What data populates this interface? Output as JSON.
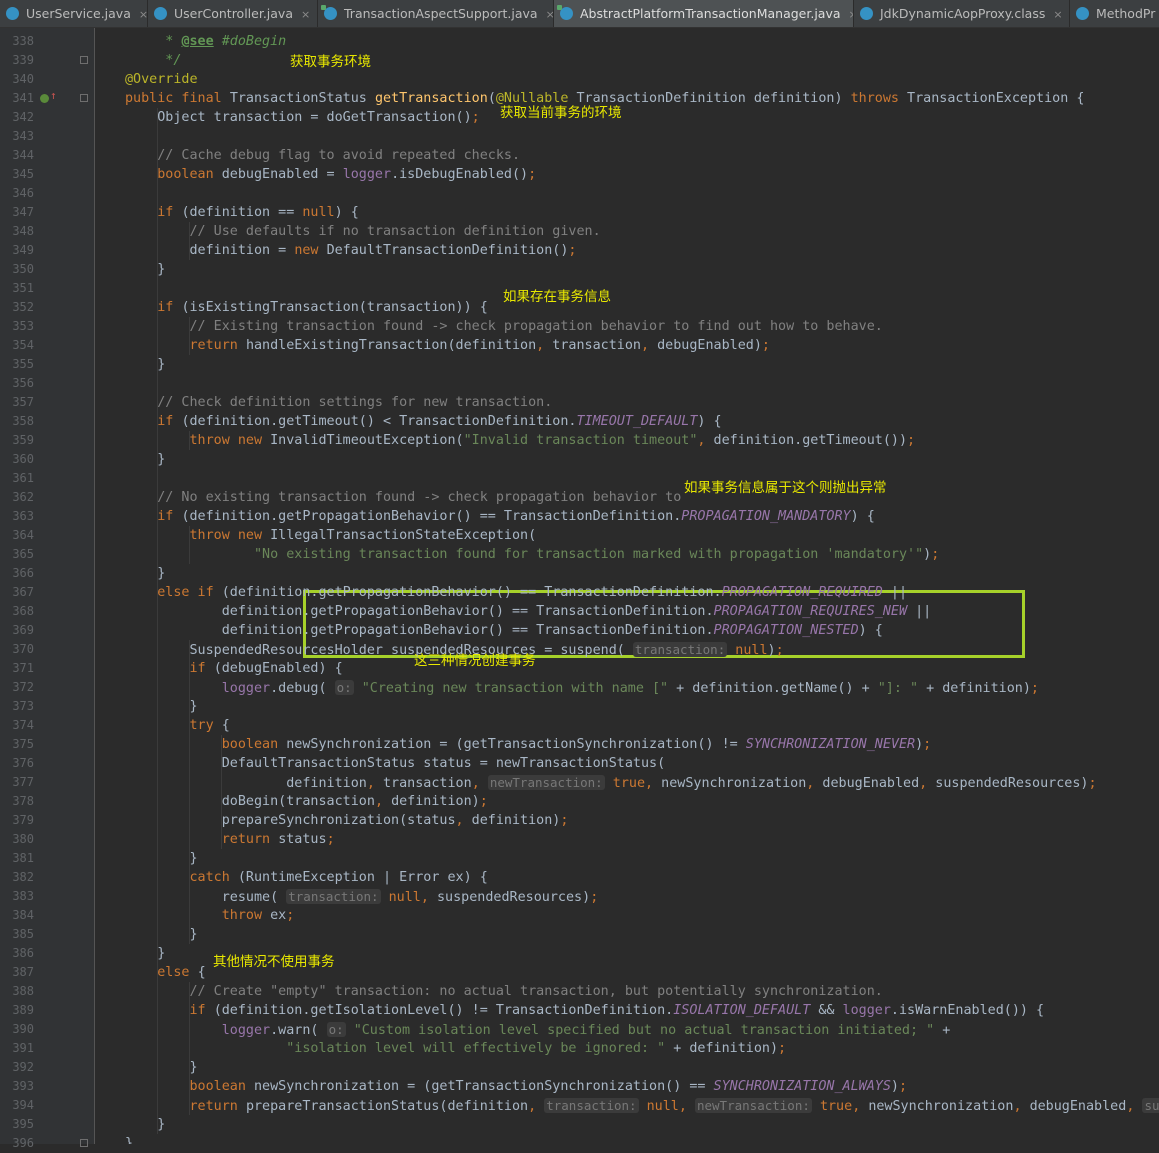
{
  "tabs": [
    {
      "label": "UserService.java",
      "icon": "java-class-icon",
      "active": false
    },
    {
      "label": "UserController.java",
      "icon": "java-class-icon",
      "active": false
    },
    {
      "label": "TransactionAspectSupport.java",
      "icon": "java-class-icon",
      "active": false
    },
    {
      "label": "AbstractPlatformTransactionManager.java",
      "icon": "java-class-icon",
      "active": true
    },
    {
      "label": "JdkDynamicAopProxy.class",
      "icon": "java-class-icon",
      "active": false
    },
    {
      "label": "MethodPr",
      "icon": "java-class-icon",
      "active": false
    }
  ],
  "line_numbers": [
    "338",
    "339",
    "340",
    "341",
    "342",
    "343",
    "344",
    "345",
    "346",
    "347",
    "348",
    "349",
    "350",
    "351",
    "352",
    "353",
    "354",
    "355",
    "356",
    "357",
    "358",
    "359",
    "360",
    "361",
    "362",
    "363",
    "364",
    "365",
    "366",
    "367",
    "368",
    "369",
    "370",
    "371",
    "372",
    "373",
    "374",
    "375",
    "376",
    "377",
    "378",
    "379",
    "380",
    "381",
    "382",
    "383",
    "384",
    "385",
    "386",
    "387",
    "388",
    "389",
    "390",
    "391",
    "392",
    "393",
    "394",
    "395",
    "396"
  ],
  "code_lines": [
    {
      "indent": "    ",
      "tokens": [
        [
          "jd",
          " * "
        ],
        [
          "jt",
          "@see"
        ],
        [
          "jd",
          " #doBegin"
        ]
      ]
    },
    {
      "indent": "    ",
      "tokens": [
        [
          "jd",
          " */"
        ]
      ]
    },
    {
      "indent": "",
      "tokens": [
        [
          "an",
          "@Override"
        ]
      ]
    },
    {
      "indent": "",
      "tokens": [
        [
          "kw",
          "public final "
        ],
        [
          "",
          "TransactionStatus "
        ],
        [
          "fn",
          "getTransaction"
        ],
        [
          "",
          "("
        ],
        [
          "an",
          "@Nullable "
        ],
        [
          "",
          "TransactionDefinition definition) "
        ],
        [
          "kw",
          "throws "
        ],
        [
          "",
          "TransactionException {"
        ]
      ]
    },
    {
      "indent": "    ",
      "tokens": [
        [
          "",
          "Object transaction = doGetTransaction()"
        ],
        [
          "kw",
          ";"
        ]
      ]
    },
    {
      "indent": "",
      "tokens": []
    },
    {
      "indent": "    ",
      "tokens": [
        [
          "cm",
          "// Cache debug flag to avoid repeated checks."
        ]
      ]
    },
    {
      "indent": "    ",
      "tokens": [
        [
          "kw",
          "boolean "
        ],
        [
          "",
          "debugEnabled = "
        ],
        [
          "fld",
          "logger"
        ],
        [
          "",
          ".isDebugEnabled()"
        ],
        [
          "kw",
          ";"
        ]
      ]
    },
    {
      "indent": "",
      "tokens": []
    },
    {
      "indent": "    ",
      "tokens": [
        [
          "kw",
          "if "
        ],
        [
          "",
          "(definition == "
        ],
        [
          "kw",
          "null"
        ],
        [
          "",
          ") {"
        ]
      ]
    },
    {
      "indent": "        ",
      "tokens": [
        [
          "cm",
          "// Use defaults if no transaction definition given."
        ]
      ]
    },
    {
      "indent": "        ",
      "tokens": [
        [
          "",
          "definition = "
        ],
        [
          "kw",
          "new "
        ],
        [
          "",
          "DefaultTransactionDefinition()"
        ],
        [
          "kw",
          ";"
        ]
      ]
    },
    {
      "indent": "    ",
      "tokens": [
        [
          "",
          "}"
        ]
      ]
    },
    {
      "indent": "",
      "tokens": []
    },
    {
      "indent": "    ",
      "tokens": [
        [
          "kw",
          "if "
        ],
        [
          "",
          "(isExistingTransaction(transaction)) {"
        ]
      ]
    },
    {
      "indent": "        ",
      "tokens": [
        [
          "cm",
          "// Existing transaction found -> check propagation behavior to find out how to behave."
        ]
      ]
    },
    {
      "indent": "        ",
      "tokens": [
        [
          "kw",
          "return "
        ],
        [
          "",
          "handleExistingTransaction(definition"
        ],
        [
          "kw",
          ", "
        ],
        [
          "",
          "transaction"
        ],
        [
          "kw",
          ", "
        ],
        [
          "",
          "debugEnabled)"
        ],
        [
          "kw",
          ";"
        ]
      ]
    },
    {
      "indent": "    ",
      "tokens": [
        [
          "",
          "}"
        ]
      ]
    },
    {
      "indent": "",
      "tokens": []
    },
    {
      "indent": "    ",
      "tokens": [
        [
          "cm",
          "// Check definition settings for new transaction."
        ]
      ]
    },
    {
      "indent": "    ",
      "tokens": [
        [
          "kw",
          "if "
        ],
        [
          "",
          "(definition.getTimeout() < TransactionDefinition."
        ],
        [
          "cn",
          "TIMEOUT_DEFAULT"
        ],
        [
          "",
          ") {"
        ]
      ]
    },
    {
      "indent": "        ",
      "tokens": [
        [
          "kw",
          "throw new "
        ],
        [
          "",
          "InvalidTimeoutException("
        ],
        [
          "st",
          "\"Invalid transaction timeout\""
        ],
        [
          "kw",
          ", "
        ],
        [
          "",
          "definition.getTimeout())"
        ],
        [
          "kw",
          ";"
        ]
      ]
    },
    {
      "indent": "    ",
      "tokens": [
        [
          "",
          "}"
        ]
      ]
    },
    {
      "indent": "",
      "tokens": []
    },
    {
      "indent": "    ",
      "tokens": [
        [
          "cm",
          "// No existing transaction found -> check propagation behavior to "
        ]
      ]
    },
    {
      "indent": "    ",
      "tokens": [
        [
          "kw",
          "if "
        ],
        [
          "",
          "(definition.getPropagationBehavior() == TransactionDefinition."
        ],
        [
          "cn",
          "PROPAGATION_MANDATORY"
        ],
        [
          "",
          ") {"
        ]
      ]
    },
    {
      "indent": "        ",
      "tokens": [
        [
          "kw",
          "throw new "
        ],
        [
          "",
          "IllegalTransactionStateException("
        ]
      ]
    },
    {
      "indent": "                ",
      "tokens": [
        [
          "st",
          "\"No existing transaction found for transaction marked with propagation 'mandatory'\""
        ],
        [
          "",
          ")"
        ],
        [
          "kw",
          ";"
        ]
      ]
    },
    {
      "indent": "    ",
      "tokens": [
        [
          "",
          "}"
        ]
      ]
    },
    {
      "indent": "    ",
      "tokens": [
        [
          "kw",
          "else if "
        ],
        [
          "",
          "(definition.getPropagationBehavior() == TransactionDefinition."
        ],
        [
          "cn",
          "PROPAGATION_REQUIRED"
        ],
        [
          "",
          " ||"
        ]
      ]
    },
    {
      "indent": "            ",
      "tokens": [
        [
          "",
          "definition.getPropagationBehavior() == TransactionDefinition."
        ],
        [
          "cn",
          "PROPAGATION_REQUIRES_NEW"
        ],
        [
          "",
          " ||"
        ]
      ]
    },
    {
      "indent": "            ",
      "tokens": [
        [
          "",
          "definition.getPropagationBehavior() == TransactionDefinition."
        ],
        [
          "cn",
          "PROPAGATION_NESTED"
        ],
        [
          "",
          ") {"
        ]
      ]
    },
    {
      "indent": "        ",
      "tokens": [
        [
          "",
          "SuspendedResourcesHolder suspendedResources = suspend( "
        ],
        [
          "hint",
          "transaction:"
        ],
        [
          "",
          " "
        ],
        [
          "kw",
          "null"
        ],
        [
          "",
          ")"
        ],
        [
          "kw",
          ";"
        ]
      ]
    },
    {
      "indent": "        ",
      "tokens": [
        [
          "kw",
          "if "
        ],
        [
          "",
          "(debugEnabled) {"
        ]
      ]
    },
    {
      "indent": "            ",
      "tokens": [
        [
          "fld",
          "logger"
        ],
        [
          "",
          ".debug( "
        ],
        [
          "hint",
          "o:"
        ],
        [
          "",
          " "
        ],
        [
          "st",
          "\"Creating new transaction with name [\""
        ],
        [
          "",
          " + definition.getName() + "
        ],
        [
          "st",
          "\"]: \""
        ],
        [
          "",
          " + definition)"
        ],
        [
          "kw",
          ";"
        ]
      ]
    },
    {
      "indent": "        ",
      "tokens": [
        [
          "",
          "}"
        ]
      ]
    },
    {
      "indent": "        ",
      "tokens": [
        [
          "kw",
          "try "
        ],
        [
          "",
          "{"
        ]
      ]
    },
    {
      "indent": "            ",
      "tokens": [
        [
          "kw",
          "boolean "
        ],
        [
          "",
          "newSynchronization = (getTransactionSynchronization() != "
        ],
        [
          "cn",
          "SYNCHRONIZATION_NEVER"
        ],
        [
          "",
          ")"
        ],
        [
          "kw",
          ";"
        ]
      ]
    },
    {
      "indent": "            ",
      "tokens": [
        [
          "",
          "DefaultTransactionStatus status = newTransactionStatus("
        ]
      ]
    },
    {
      "indent": "                    ",
      "tokens": [
        [
          "",
          "definition"
        ],
        [
          "kw",
          ", "
        ],
        [
          "",
          "transaction"
        ],
        [
          "kw",
          ", "
        ],
        [
          "hint",
          "newTransaction:"
        ],
        [
          "",
          " "
        ],
        [
          "kw",
          "true"
        ],
        [
          "kw",
          ", "
        ],
        [
          "",
          "newSynchronization"
        ],
        [
          "kw",
          ", "
        ],
        [
          "",
          "debugEnabled"
        ],
        [
          "kw",
          ", "
        ],
        [
          "",
          "suspendedResources)"
        ],
        [
          "kw",
          ";"
        ]
      ]
    },
    {
      "indent": "            ",
      "tokens": [
        [
          "",
          "doBegin(transaction"
        ],
        [
          "kw",
          ", "
        ],
        [
          "",
          "definition)"
        ],
        [
          "kw",
          ";"
        ]
      ]
    },
    {
      "indent": "            ",
      "tokens": [
        [
          "",
          "prepareSynchronization(status"
        ],
        [
          "kw",
          ", "
        ],
        [
          "",
          "definition)"
        ],
        [
          "kw",
          ";"
        ]
      ]
    },
    {
      "indent": "            ",
      "tokens": [
        [
          "kw",
          "return "
        ],
        [
          "",
          "status"
        ],
        [
          "kw",
          ";"
        ]
      ]
    },
    {
      "indent": "        ",
      "tokens": [
        [
          "",
          "}"
        ]
      ]
    },
    {
      "indent": "        ",
      "tokens": [
        [
          "kw",
          "catch "
        ],
        [
          "",
          "(RuntimeException | Error ex) {"
        ]
      ]
    },
    {
      "indent": "            ",
      "tokens": [
        [
          "",
          "resume( "
        ],
        [
          "hint",
          "transaction:"
        ],
        [
          "",
          " "
        ],
        [
          "kw",
          "null"
        ],
        [
          "kw",
          ", "
        ],
        [
          "",
          "suspendedResources)"
        ],
        [
          "kw",
          ";"
        ]
      ]
    },
    {
      "indent": "            ",
      "tokens": [
        [
          "kw",
          "throw "
        ],
        [
          "",
          "ex"
        ],
        [
          "kw",
          ";"
        ]
      ]
    },
    {
      "indent": "        ",
      "tokens": [
        [
          "",
          "}"
        ]
      ]
    },
    {
      "indent": "    ",
      "tokens": [
        [
          "",
          "}"
        ]
      ]
    },
    {
      "indent": "    ",
      "tokens": [
        [
          "kw",
          "else "
        ],
        [
          "",
          "{"
        ]
      ]
    },
    {
      "indent": "        ",
      "tokens": [
        [
          "cm",
          "// Create \"empty\" transaction: no actual transaction, but potentially synchronization."
        ]
      ]
    },
    {
      "indent": "        ",
      "tokens": [
        [
          "kw",
          "if "
        ],
        [
          "",
          "(definition.getIsolationLevel() != TransactionDefinition."
        ],
        [
          "cn",
          "ISOLATION_DEFAULT"
        ],
        [
          "",
          " && "
        ],
        [
          "fld",
          "logger"
        ],
        [
          "",
          ".isWarnEnabled()) {"
        ]
      ]
    },
    {
      "indent": "            ",
      "tokens": [
        [
          "fld",
          "logger"
        ],
        [
          "",
          ".warn( "
        ],
        [
          "hint",
          "o:"
        ],
        [
          "",
          " "
        ],
        [
          "st",
          "\"Custom isolation level specified but no actual transaction initiated; \""
        ],
        [
          "",
          " +"
        ]
      ]
    },
    {
      "indent": "                    ",
      "tokens": [
        [
          "st",
          "\"isolation level will effectively be ignored: \""
        ],
        [
          "",
          " + definition)"
        ],
        [
          "kw",
          ";"
        ]
      ]
    },
    {
      "indent": "        ",
      "tokens": [
        [
          "",
          "}"
        ]
      ]
    },
    {
      "indent": "        ",
      "tokens": [
        [
          "kw",
          "boolean "
        ],
        [
          "",
          "newSynchronization = (getTransactionSynchronization() == "
        ],
        [
          "cn",
          "SYNCHRONIZATION_ALWAYS"
        ],
        [
          "",
          ")"
        ],
        [
          "kw",
          ";"
        ]
      ]
    },
    {
      "indent": "        ",
      "tokens": [
        [
          "kw",
          "return "
        ],
        [
          "",
          "prepareTransactionStatus(definition"
        ],
        [
          "kw",
          ", "
        ],
        [
          "hint",
          "transaction:"
        ],
        [
          "",
          " "
        ],
        [
          "kw",
          "null"
        ],
        [
          "kw",
          ", "
        ],
        [
          "hint",
          "newTransaction:"
        ],
        [
          "",
          " "
        ],
        [
          "kw",
          "true"
        ],
        [
          "kw",
          ", "
        ],
        [
          "",
          "newSynchronization"
        ],
        [
          "kw",
          ", "
        ],
        [
          "",
          "debugEnabled"
        ],
        [
          "kw",
          ", "
        ],
        [
          "hint",
          "susp"
        ]
      ]
    },
    {
      "indent": "    ",
      "tokens": [
        [
          "",
          "}"
        ]
      ]
    },
    {
      "indent": "",
      "tokens": [
        [
          "",
          "}"
        ]
      ]
    }
  ],
  "annotations": {
    "get_env": "获取事务环境",
    "get_current_env": "获取当前事务的环境",
    "if_exists": "如果存在事务信息",
    "mandatory_throw": "如果事务信息属于这个则抛出异常",
    "three_cases": "这三种情况创建事务",
    "other_cases": "其他情况不使用事务"
  },
  "colors": {
    "editor_bg": "#2b2b2b",
    "gutter_bg": "#313335",
    "annotation": "#e8e800",
    "highlight_border": "#a6d12a"
  }
}
